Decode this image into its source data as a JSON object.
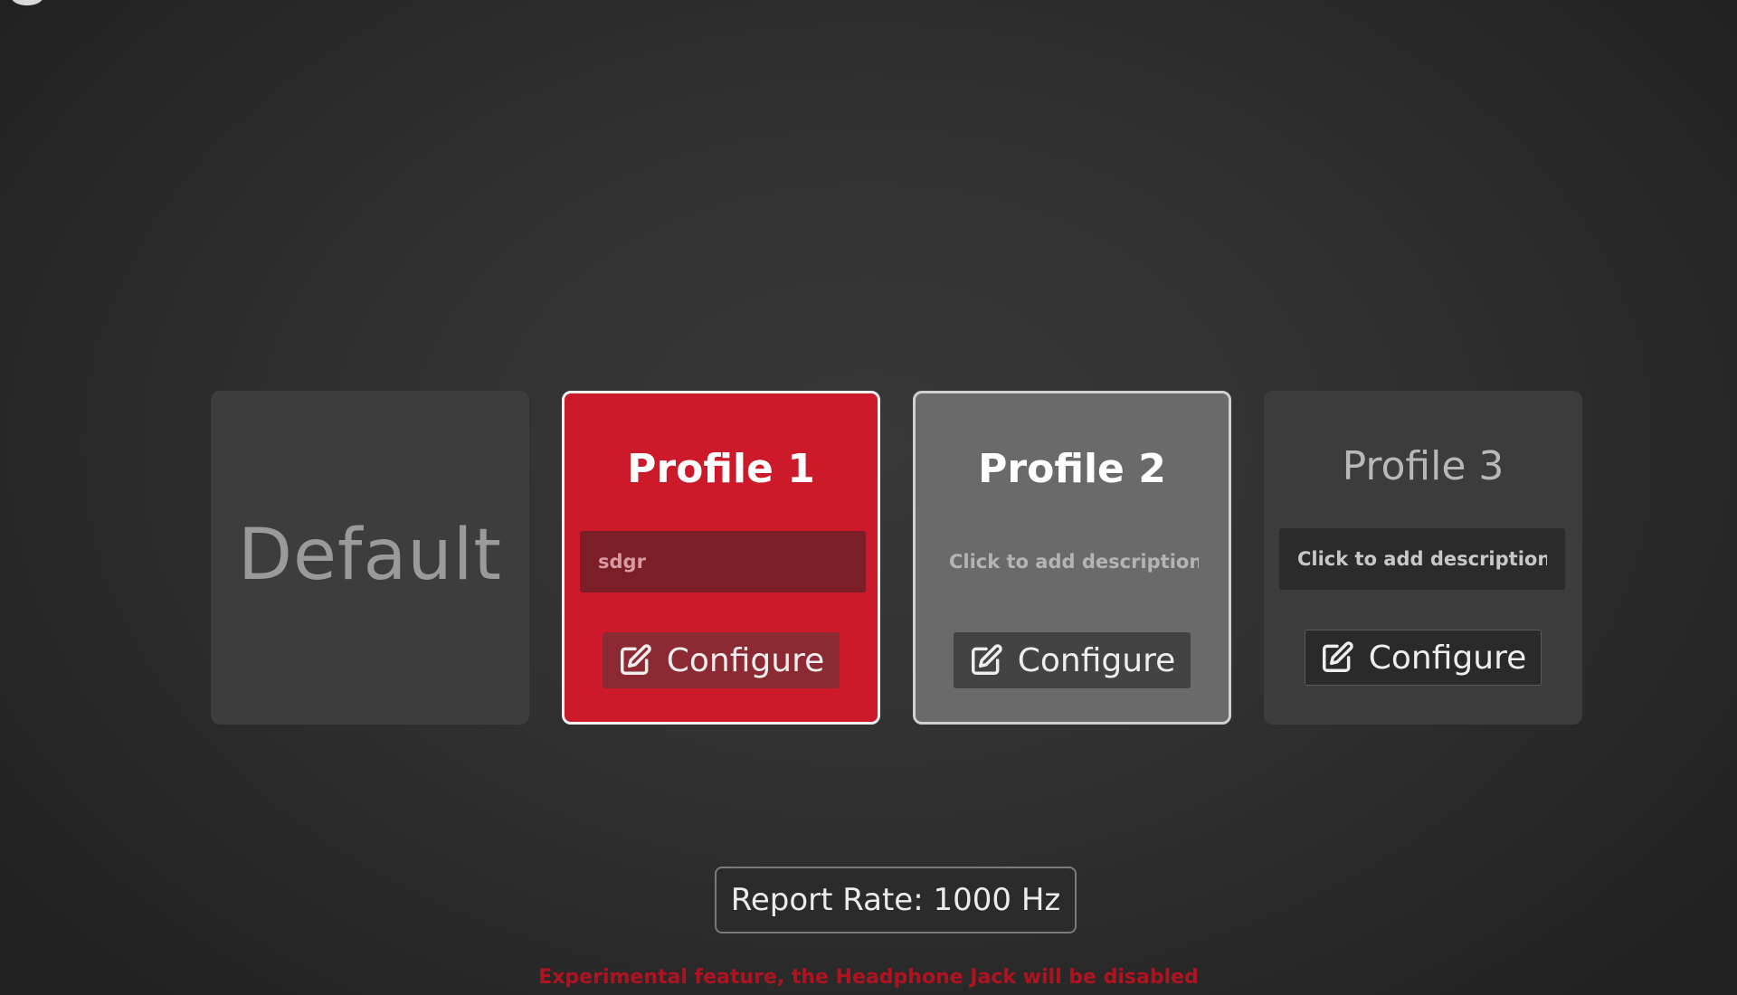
{
  "profiles": {
    "default": {
      "title": "Default"
    },
    "items": [
      {
        "title": "Profile 1",
        "description": "sdgr",
        "placeholder": "Click to add description",
        "configure_label": "Configure",
        "state": "active"
      },
      {
        "title": "Profile 2",
        "description": "",
        "placeholder": "Click to add description",
        "configure_label": "Configure",
        "state": "hover"
      },
      {
        "title": "Profile 3",
        "description": "",
        "placeholder": "Click to add description",
        "configure_label": "Configure",
        "state": "inactive"
      }
    ]
  },
  "report_rate": {
    "label": "Report Rate: 1000 Hz"
  },
  "warning": {
    "text": "Experimental feature, the Headphone Jack will be disabled"
  },
  "colors": {
    "active_profile": "#cc1a2a",
    "hover_profile": "#6a6a6a",
    "inactive_profile": "#3c3c3c",
    "warning": "#b01320"
  },
  "icons": {
    "configure": "edit-icon"
  }
}
